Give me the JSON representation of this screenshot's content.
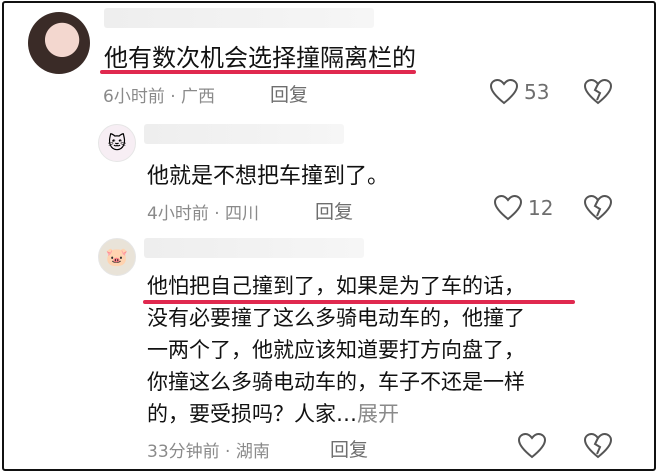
{
  "comments": [
    {
      "text": "他有数次机会选择撞隔离栏的",
      "time": "6小时前",
      "location": "广西",
      "reply_label": "回复",
      "likes": "53"
    },
    {
      "text": "他就是不想把车撞到了。",
      "time": "4小时前",
      "location": "四川",
      "reply_label": "回复",
      "likes": "12"
    },
    {
      "lines": [
        "他怕把自己撞到了，如果是为了车的话，",
        "没有必要撞了这么多骑电动车的，他撞了",
        "一两个了，他就应该知道要打方向盘了，",
        "你撞这么多骑电动车的，车子不还是一样",
        "的，要受损吗？人家…"
      ],
      "expand_label": "展开",
      "time": "33分钟前",
      "location": "湖南",
      "reply_label": "回复",
      "likes": ""
    }
  ],
  "meta_separator": " · ",
  "icons": {
    "like": "heart-outline-icon",
    "dislike": "broken-heart-icon"
  },
  "colors": {
    "highlight": "#e0294f",
    "meta": "#8a8a8a",
    "text": "#111111"
  }
}
